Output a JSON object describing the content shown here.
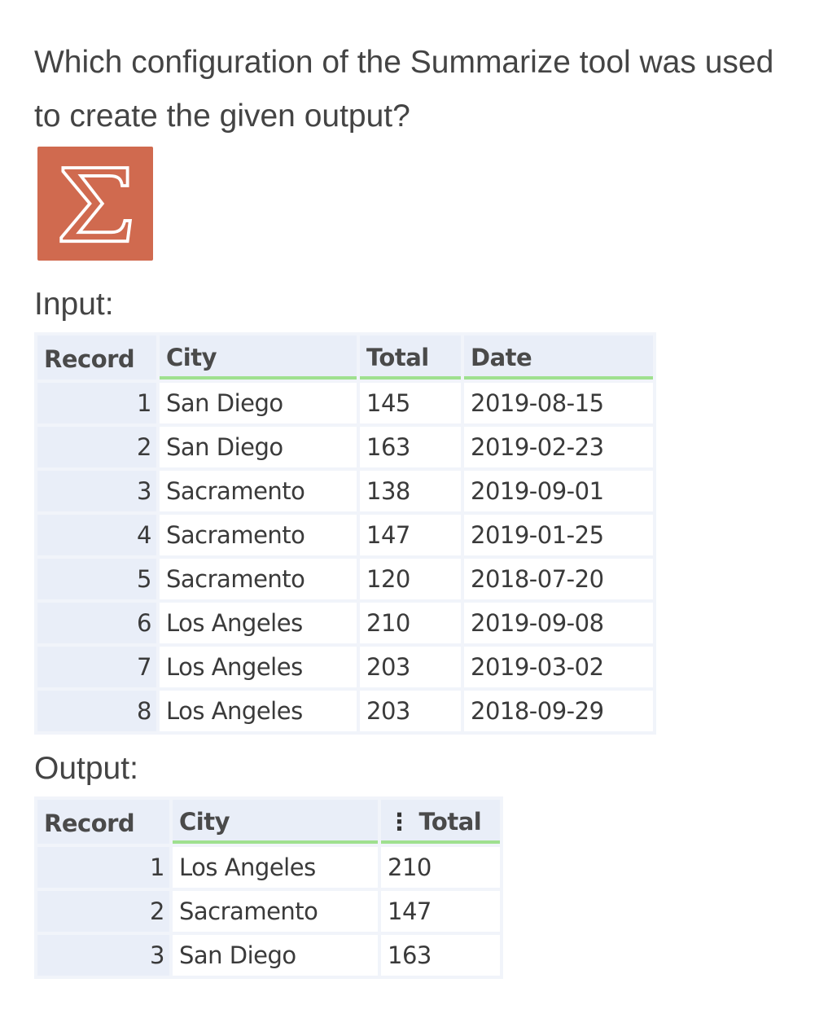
{
  "question": "Which configuration of the Summarize tool was used to create the given output?",
  "icon": {
    "name": "summarize-sigma-icon",
    "glyph": "Σ",
    "color": "#d06a4f"
  },
  "input": {
    "label": "Input:",
    "headers": [
      "Record",
      "City",
      "Total",
      "Date"
    ],
    "rows": [
      [
        "1",
        "San Diego",
        "145",
        "2019-08-15"
      ],
      [
        "2",
        "San Diego",
        "163",
        "2019-02-23"
      ],
      [
        "3",
        "Sacramento",
        "138",
        "2019-09-01"
      ],
      [
        "4",
        "Sacramento",
        "147",
        "2019-01-25"
      ],
      [
        "5",
        "Sacramento",
        "120",
        "2018-07-20"
      ],
      [
        "6",
        "Los Angeles",
        "210",
        "2019-09-08"
      ],
      [
        "7",
        "Los Angeles",
        "203",
        "2019-03-02"
      ],
      [
        "8",
        "Los Angeles",
        "203",
        "2018-09-29"
      ]
    ]
  },
  "output": {
    "label": "Output:",
    "headers": [
      "Record",
      "City",
      "Total"
    ],
    "rows": [
      [
        "1",
        "Los Angeles",
        "210"
      ],
      [
        "2",
        "Sacramento",
        "147"
      ],
      [
        "3",
        "San Diego",
        "163"
      ]
    ]
  }
}
